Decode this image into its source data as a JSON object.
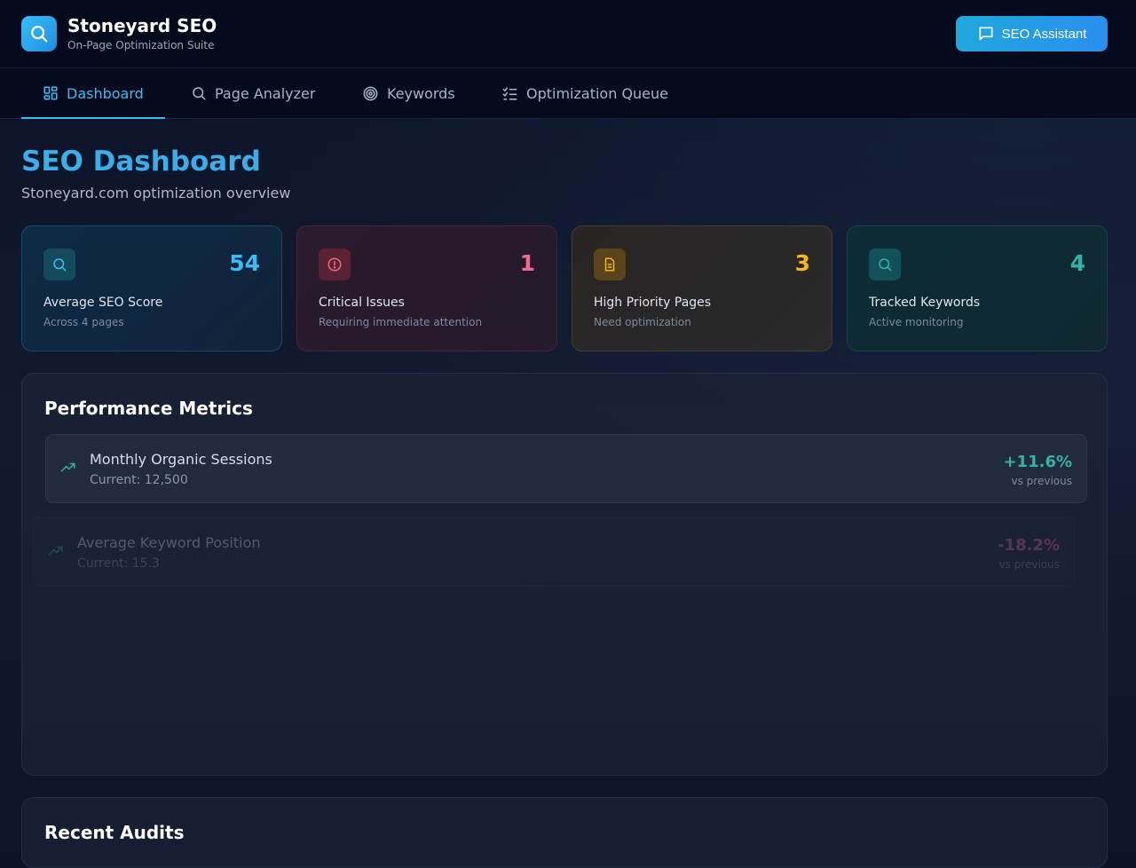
{
  "app": {
    "title": "Stoneyard SEO",
    "subtitle": "On-Page Optimization Suite",
    "assistant_label": "SEO Assistant"
  },
  "nav": {
    "tabs": [
      {
        "label": "Dashboard",
        "icon": "dashboard-icon",
        "active": true
      },
      {
        "label": "Page Analyzer",
        "icon": "search-icon",
        "active": false
      },
      {
        "label": "Keywords",
        "icon": "target-icon",
        "active": false
      },
      {
        "label": "Optimization Queue",
        "icon": "checklist-icon",
        "active": false
      }
    ]
  },
  "page": {
    "title": "SEO Dashboard",
    "subtitle": "Stoneyard.com optimization overview"
  },
  "stats": [
    {
      "value": "54",
      "label": "Average SEO Score",
      "sub": "Across 4 pages",
      "icon": "search-icon",
      "color": "#38bdf8"
    },
    {
      "value": "1",
      "label": "Critical Issues",
      "sub": "Requiring immediate attention",
      "icon": "alert-circle-icon",
      "color": "#f06a8a"
    },
    {
      "value": "3",
      "label": "High Priority Pages",
      "sub": "Need optimization",
      "icon": "document-icon",
      "color": "#f5b51e"
    },
    {
      "value": "4",
      "label": "Tracked Keywords",
      "sub": "Active monitoring",
      "icon": "search-icon",
      "color": "#2fb5a5"
    }
  ],
  "performance": {
    "title": "Performance Metrics",
    "metrics": [
      {
        "name": "Monthly Organic Sessions",
        "current": "Current: 12,500",
        "change": "+11.6%",
        "vs": "vs previous",
        "color": "#2fb5a5"
      },
      {
        "name": "Average Keyword Position",
        "current": "Current: 15.3",
        "change": "-18.2%",
        "vs": "vs previous",
        "color": "#f06a8a"
      }
    ]
  },
  "audits": {
    "title": "Recent Audits"
  }
}
